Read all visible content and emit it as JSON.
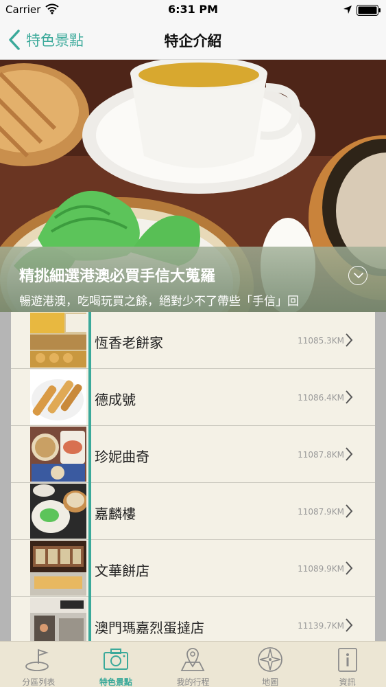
{
  "status_bar": {
    "carrier": "Carrier",
    "time": "6:31 PM"
  },
  "nav": {
    "back_label": "特色景點",
    "title": "特企介紹"
  },
  "hero": {
    "title": "精挑細選港澳必買手信大蒐羅",
    "description": "暢遊港澳，吃喝玩買之餘，絕對少不了帶些「手信」回"
  },
  "list": [
    {
      "name": "恆香老餅家",
      "distance": "11085.3KM"
    },
    {
      "name": "德成號",
      "distance": "11086.4KM"
    },
    {
      "name": "珍妮曲奇",
      "distance": "11087.8KM"
    },
    {
      "name": "嘉麟樓",
      "distance": "11087.9KM"
    },
    {
      "name": "文華餅店",
      "distance": "11089.9KM"
    },
    {
      "name": "澳門瑪嘉烈蛋撻店",
      "distance": "11139.7KM"
    }
  ],
  "tabs": [
    {
      "label": "分區列表",
      "icon": "flag-map-icon",
      "active": false
    },
    {
      "label": "特色景點",
      "icon": "camera-icon",
      "active": true
    },
    {
      "label": "我的行程",
      "icon": "map-pin-icon",
      "active": false
    },
    {
      "label": "地圖",
      "icon": "compass-icon",
      "active": false
    },
    {
      "label": "資訊",
      "icon": "info-icon",
      "active": false
    }
  ],
  "colors": {
    "accent": "#3aa99a",
    "tab_bar_bg": "#ece6d4",
    "list_bg": "#f4f1e6"
  }
}
